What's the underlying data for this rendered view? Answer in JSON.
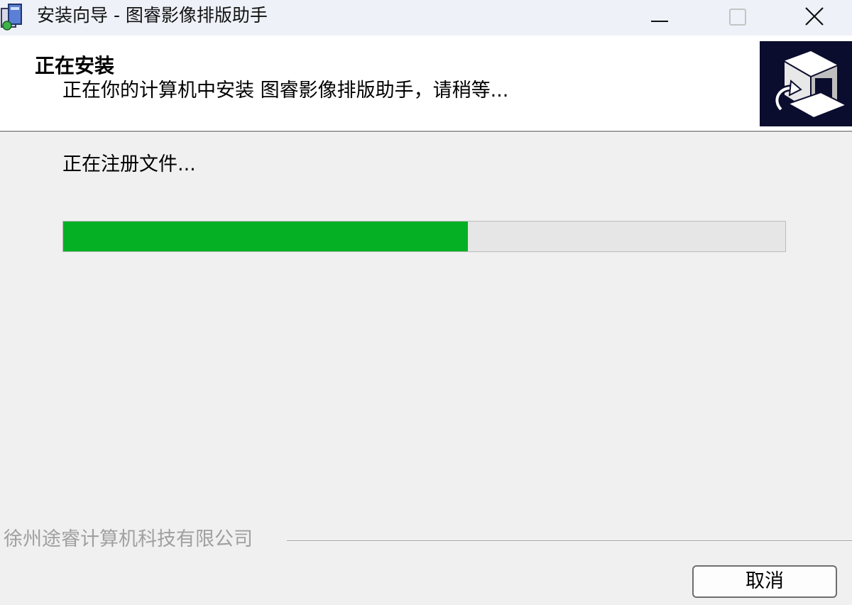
{
  "window": {
    "title": "安装向导 - 图睿影像排版助手",
    "icons": {
      "app": "installer-icon",
      "minimize": "minimize-icon",
      "maximize": "maximize-icon",
      "close": "close-icon"
    }
  },
  "header": {
    "title": "正在安装",
    "subtitle": "正在你的计算机中安装 图睿影像排版助手，请稍等...",
    "image_icon": "computer-install-icon"
  },
  "body": {
    "status": "正在注册文件...",
    "progress": 0.56,
    "progress_color": "#06b025"
  },
  "footer": {
    "company": "徐州途睿计算机科技有限公司",
    "cancel_label": "取消"
  }
}
